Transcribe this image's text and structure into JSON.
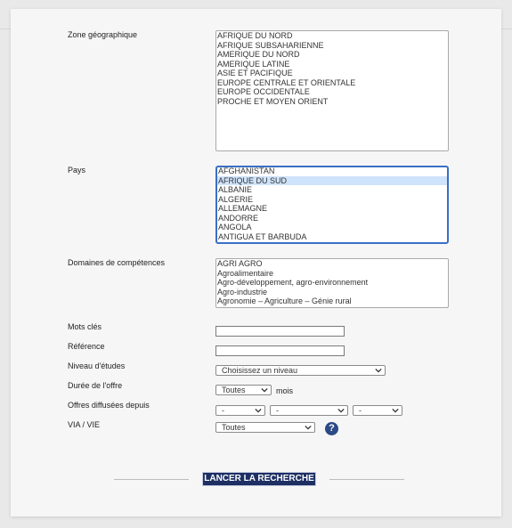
{
  "form": {
    "zone": {
      "label": "Zone géographique",
      "options": [
        "AFRIQUE DU NORD",
        "AFRIQUE SUBSAHARIENNE",
        "AMERIQUE DU NORD",
        "AMERIQUE LATINE",
        "ASIE ET PACIFIQUE",
        "EUROPE CENTRALE ET ORIENTALE",
        "EUROPE OCCIDENTALE",
        "PROCHE ET MOYEN ORIENT"
      ]
    },
    "pays": {
      "label": "Pays",
      "options": [
        "AFGHANISTAN",
        "AFRIQUE DU SUD",
        "ALBANIE",
        "ALGERIE",
        "ALLEMAGNE",
        "ANDORRE",
        "ANGOLA",
        "ANTIGUA ET BARBUDA"
      ],
      "selected": "AFRIQUE DU SUD"
    },
    "domaines": {
      "label": "Domaines de compétences",
      "options": [
        "AGRI AGRO",
        "Agroalimentaire",
        "Agro-développement, agro-environnement",
        "Agro-industrie",
        "Agronomie – Agriculture – Génie rural"
      ]
    },
    "mots_cles": {
      "label": "Mots clés",
      "value": ""
    },
    "reference": {
      "label": "Référence",
      "value": ""
    },
    "niveau": {
      "label": "Niveau d'études",
      "value": "Choisissez un niveau"
    },
    "duree": {
      "label": "Durée de l'offre",
      "value": "Toutes",
      "unit": "mois"
    },
    "depuis": {
      "label": "Offres diffusées depuis",
      "day": "-",
      "month": "-",
      "year": "-"
    },
    "via": {
      "label": "VIA / VIE",
      "value": "Toutes",
      "help_icon": "question-circle-icon"
    },
    "submit_label": "LANCER LA RECHERCHE"
  },
  "colors": {
    "accent": "#1d2f63",
    "focus": "#3a6fc4",
    "selected_row": "#cfe3fb",
    "help": "#2c4a86"
  }
}
